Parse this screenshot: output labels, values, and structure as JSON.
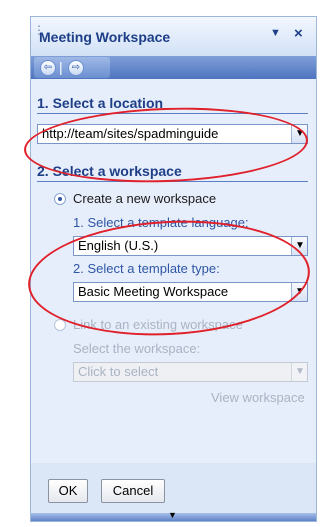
{
  "pane": {
    "title": "Meeting Workspace",
    "dropdown_glyph": "▼",
    "close_glyph": "×",
    "nav_back_glyph": "⇦",
    "nav_forward_glyph": "⇨",
    "nav_separator": "|"
  },
  "location": {
    "heading": "1. Select a location",
    "value": "http://team/sites/spadminguide"
  },
  "workspace": {
    "heading": "2. Select a workspace",
    "create_option_label": "Create a new workspace",
    "language_label": "1. Select a template language:",
    "language_value": "English (U.S.)",
    "template_label": "2. Select a template type:",
    "template_value": "Basic Meeting Workspace",
    "link_option_label": "Link to an existing workspace",
    "select_label": "Select the workspace:",
    "select_value": "Click to select",
    "view_link": "View workspace"
  },
  "buttons": {
    "ok": "OK",
    "cancel": "Cancel"
  },
  "icons": {
    "dropdown": "▼",
    "scroll_down": "▼"
  },
  "colors": {
    "heading": "#1e3f87",
    "annotation": "#e0202a",
    "pane_background": "#dbe7f7"
  }
}
